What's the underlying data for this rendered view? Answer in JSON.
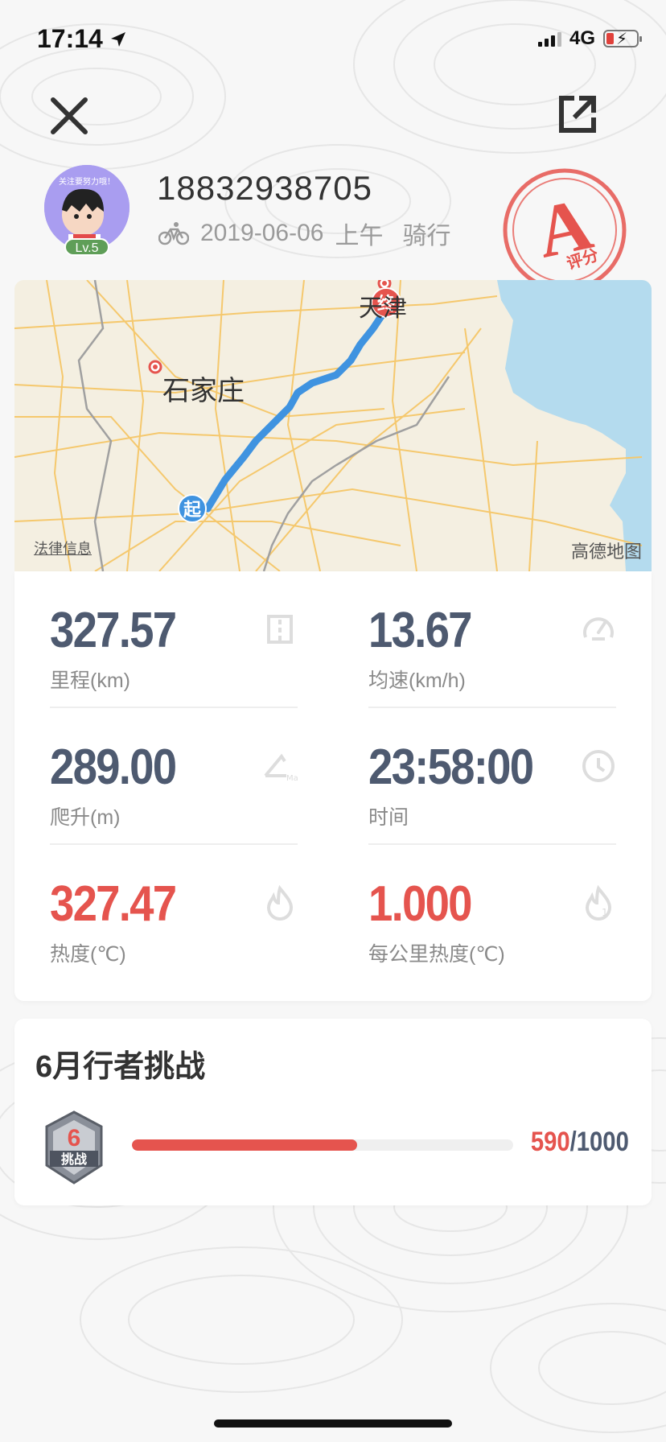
{
  "status_bar": {
    "time": "17:14",
    "network": "4G",
    "location_icon": "location-arrow-icon"
  },
  "header": {
    "close_icon": "close-icon",
    "share_icon": "share-icon",
    "user": {
      "name": "18832938705",
      "level": "Lv.5",
      "avatar_text": "关注要努力哦！"
    },
    "ride": {
      "icon": "bicycle-icon",
      "date": "2019-06-06",
      "period": "上午",
      "type": "骑行"
    },
    "grade": {
      "letter": "A",
      "label": "评分",
      "color": "#e5544e"
    }
  },
  "map": {
    "start_marker": "起",
    "end_marker": "终",
    "city_label": "石家庄",
    "destination_label": "天津",
    "legal_link": "法律信息",
    "provider": "高德地图",
    "route_color": "#3f93e0"
  },
  "stats": [
    {
      "value": "327.57",
      "label": "里程(km)",
      "icon": "road-icon",
      "accent": false
    },
    {
      "value": "13.67",
      "label": "均速(km/h)",
      "icon": "speedometer-icon",
      "accent": false
    },
    {
      "value": "289.00",
      "label": "爬升(m)",
      "icon": "climb-max-icon",
      "accent": false
    },
    {
      "value": "23:58:00",
      "label": "时间",
      "icon": "clock-icon",
      "accent": false
    },
    {
      "value": "327.47",
      "label": "热度(℃)",
      "icon": "flame-icon",
      "accent": true
    },
    {
      "value": "1.000",
      "label": "每公里热度(℃)",
      "icon": "flame-per-km-icon",
      "accent": true
    }
  ],
  "challenge": {
    "title": "6月行者挑战",
    "badge_icon": "challenge-badge-icon",
    "badge_text": "挑战",
    "current": "590",
    "separator": "/",
    "target": "1000",
    "progress_fraction": 0.59,
    "accent_color": "#e5544e"
  }
}
